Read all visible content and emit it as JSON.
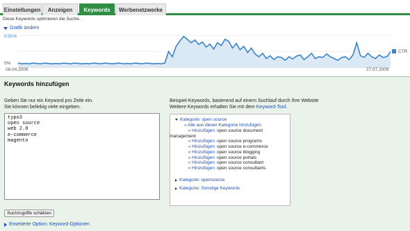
{
  "tabs": [
    {
      "label": "Einstellungen",
      "active": false
    },
    {
      "label": "Anzeigen",
      "active": false
    },
    {
      "label": "Keywords",
      "active": true
    },
    {
      "label": "Werbenetzwerke",
      "active": false
    }
  ],
  "optimize_note": "Diese Keywords optimieren die Suche.",
  "chart_toggle": "Grafik ändern",
  "chart_data": {
    "type": "line",
    "series": [
      {
        "name": "CTR",
        "color": "#3a83c8",
        "values": [
          0.12,
          0.1,
          0.11,
          0.1,
          0.12,
          0.11,
          0.1,
          0.12,
          0.11,
          0.1,
          0.11,
          0.1,
          0.12,
          0.11,
          0.1,
          0.12,
          0.11,
          0.1,
          0.11,
          0.1,
          0.12,
          0.11,
          0.1,
          0.12,
          0.11,
          0.1,
          0.11,
          0.12,
          0.1,
          0.11,
          0.1,
          0.12,
          0.11,
          0.1,
          0.12,
          0.11,
          0.1,
          0.11,
          0.1,
          0.12,
          0.45,
          0.3,
          0.6,
          0.75,
          0.88,
          0.8,
          0.7,
          0.78,
          0.65,
          0.72,
          0.58,
          0.66,
          0.52,
          0.7,
          0.62,
          0.8,
          0.74,
          0.55,
          0.68,
          0.5,
          0.6,
          0.42,
          0.55,
          0.38,
          0.3,
          0.4,
          0.25,
          0.33,
          0.22,
          0.3,
          0.28,
          0.2,
          0.3,
          0.24,
          0.32,
          0.35,
          0.22,
          0.3,
          0.4,
          0.25,
          0.3,
          0.28,
          0.38,
          0.3,
          0.25,
          0.2,
          0.28,
          0.3,
          0.22,
          0.35,
          0.7,
          0.33,
          0.28,
          0.4,
          0.3,
          0.25,
          0.35,
          0.28,
          0.3,
          0.45
        ]
      }
    ],
    "y_top_label": "0.91%",
    "y_bottom_label": "0%",
    "x_start_label": "08.04.2006",
    "x_end_label": "27.07.2009",
    "ylim": [
      0,
      0.91
    ],
    "grid": true
  },
  "section_title": "Keywords hinzufügen",
  "instructions": [
    "Geben Sie nur ein Keyword pro Zeile ein.",
    "Sie können beliebig viele eingeben."
  ],
  "keywords_text": "typo3\nopen source\nweb 2.0\ne-commerce\nmagento",
  "example_intro": "Beispiel-Keywords, basierend auf einem Suchlauf durch Ihre Website",
  "more_prefix": "Weitere Keywords erhalten Sie mit dem",
  "keyword_tool": "Keyword-Tool",
  "more_suffix": ".",
  "suggestions": {
    "category1": "Kategorie: open source",
    "add_all": "« Alle aus dieser Kategorie hinzufügen",
    "add_label": "« Hinzufügen",
    "items": [
      "open source document",
      "open source programs",
      "open source e-commerce",
      "open source blogging",
      "open source portals",
      "open source consultant",
      "open source consultants"
    ],
    "item1_cont": "management",
    "category2": "Kategorie: opensource",
    "category3": "Kategorie: Sonstige Keywords"
  },
  "estimate_button": "Suchzugriffe schätzen",
  "advanced_option": "Erweiterte Option: Keyword-Optionen",
  "icons": {
    "toggle": "triangle-down-icon",
    "expand": "triangle-right-icon"
  }
}
